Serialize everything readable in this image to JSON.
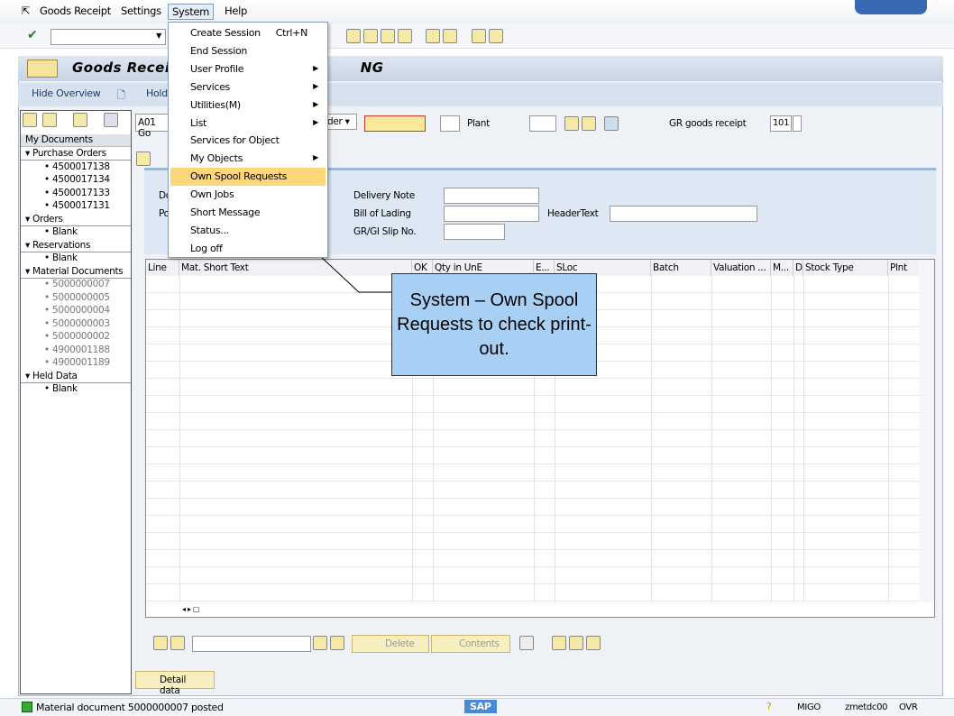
{
  "menubar": {
    "items": [
      "Goods Receipt",
      "Settings",
      "System",
      "Help"
    ]
  },
  "title": {
    "left": "Goods Receip",
    "right": "NG"
  },
  "appbar": {
    "hide_overview": "Hide Overview",
    "hold": "Hold"
  },
  "sidebar": {
    "header": "My Documents",
    "groups": [
      {
        "label": "Purchase Orders",
        "items": [
          "4500017138",
          "4500017134",
          "4500017133",
          "4500017131"
        ]
      },
      {
        "label": "Orders",
        "items": [
          "Blank"
        ]
      },
      {
        "label": "Reservations",
        "items": [
          "Blank"
        ]
      },
      {
        "label": "Material Documents",
        "items": [
          "5000000007",
          "5000000005",
          "5000000004",
          "5000000003",
          "5000000002",
          "4900001188",
          "4900001189"
        ]
      },
      {
        "label": "Held Data",
        "items": [
          "Blank"
        ]
      }
    ]
  },
  "header": {
    "action": "A01 Go",
    "ref_doc": "der",
    "plant_label": "Plant",
    "gr_label": "GR goods receipt",
    "movement_type": "101",
    "partial_labels": [
      "Do",
      "Po"
    ],
    "delivery_note": "Delivery Note",
    "bill_of_lading": "Bill of Lading",
    "header_text": "HeaderText",
    "slip_no": "GR/GI Slip No."
  },
  "grid": {
    "columns": [
      "Line",
      "Mat. Short Text",
      "OK",
      "Qty in UnE",
      "E...",
      "SLoc",
      "Batch",
      "Valuation ...",
      "M...",
      "D",
      "Stock Type",
      "Plnt"
    ]
  },
  "bottom": {
    "delete": "Delete",
    "contents": "Contents",
    "detail_data": "Detail data"
  },
  "menu": {
    "items": [
      {
        "label": "Create Session",
        "shortcut": "Ctrl+N"
      },
      {
        "label": "End Session"
      },
      {
        "label": "User Profile",
        "submenu": true
      },
      {
        "label": "Services",
        "submenu": true
      },
      {
        "label": "Utilities(M)",
        "submenu": true
      },
      {
        "label": "List",
        "submenu": true
      },
      {
        "label": "Services for Object"
      },
      {
        "label": "My Objects",
        "submenu": true
      },
      {
        "label": "Own Spool Requests",
        "highlighted": true
      },
      {
        "label": "Own Jobs"
      },
      {
        "label": "Short Message"
      },
      {
        "label": "Status..."
      },
      {
        "label": "Log off"
      }
    ]
  },
  "callout": {
    "text": "System – Own Spool Requests to check print-out."
  },
  "status": {
    "message": "Material document 5000000007 posted",
    "transaction": "MIGO",
    "server": "zmetdc00",
    "mode": "OVR",
    "logo": "SAP"
  },
  "colors": {
    "highlight": "#fbd77a",
    "callout": "#a8d0f5",
    "required_field": "#fbe99a"
  }
}
